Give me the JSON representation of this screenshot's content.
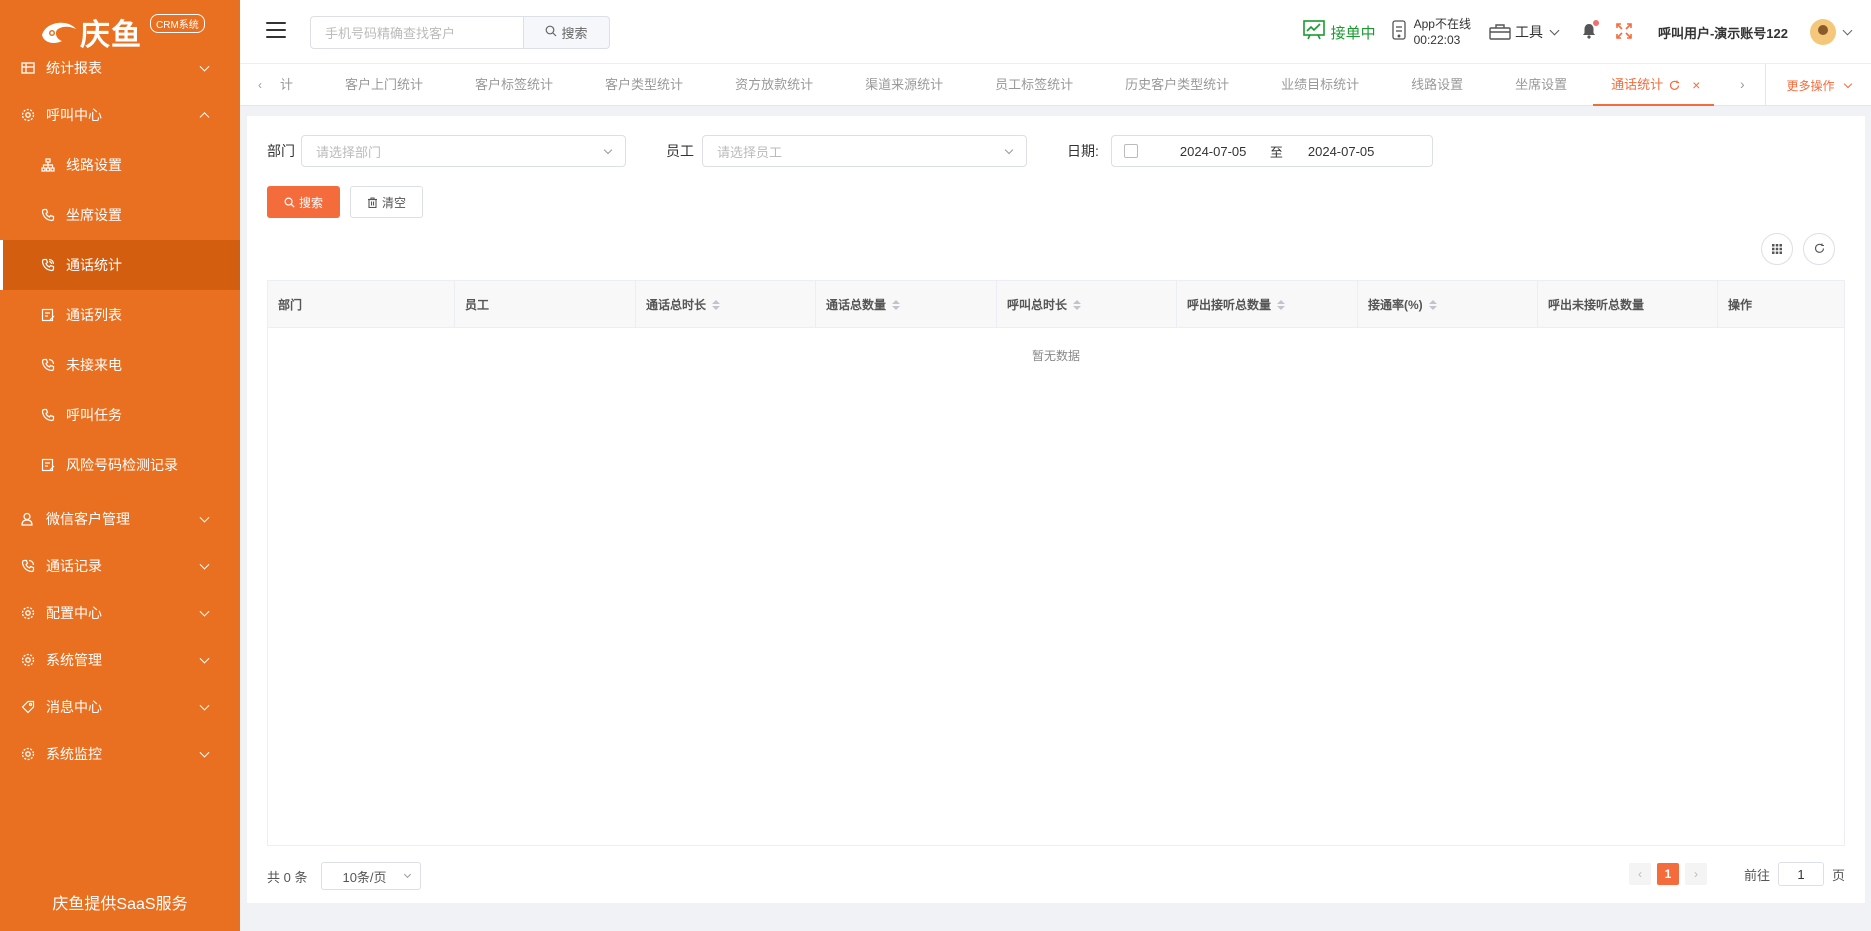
{
  "logo": {
    "text": "庆鱼",
    "badge": "CRM系统"
  },
  "sidebar": {
    "items": [
      {
        "label": "统计报表",
        "icon": "table-icon",
        "expanded": false
      },
      {
        "label": "呼叫中心",
        "icon": "gear-icon",
        "expanded": true,
        "children": [
          {
            "label": "线路设置",
            "icon": "sitemap-icon"
          },
          {
            "label": "坐席设置",
            "icon": "phone-icon"
          },
          {
            "label": "通话统计",
            "icon": "phone-call-icon",
            "active": true
          },
          {
            "label": "通话列表",
            "icon": "edit-list-icon"
          },
          {
            "label": "未接来电",
            "icon": "phone-call-icon"
          },
          {
            "label": "呼叫任务",
            "icon": "phone-icon"
          },
          {
            "label": "风险号码检测记录",
            "icon": "edit-list-icon"
          }
        ]
      },
      {
        "label": "微信客户管理",
        "icon": "user-icon",
        "expanded": false
      },
      {
        "label": "通话记录",
        "icon": "phone-call-icon",
        "expanded": false
      },
      {
        "label": "配置中心",
        "icon": "gear-icon",
        "expanded": false
      },
      {
        "label": "系统管理",
        "icon": "gear-icon",
        "expanded": false
      },
      {
        "label": "消息中心",
        "icon": "tag-icon",
        "expanded": false
      },
      {
        "label": "系统监控",
        "icon": "gear-icon",
        "expanded": false
      }
    ],
    "footer": "庆鱼提供SaaS服务"
  },
  "header": {
    "search_placeholder": "手机号码精确查找客户",
    "search_button": "搜索",
    "status": "接单中",
    "app_status_line1": "App不在线",
    "app_status_line2": "00:22:03",
    "tools": "工具",
    "username": "呼叫用户-演示账号122"
  },
  "tabs": {
    "items": [
      "计",
      "客户上门统计",
      "客户标签统计",
      "客户类型统计",
      "资方放款统计",
      "渠道来源统计",
      "员工标签统计",
      "历史客户类型统计",
      "业绩目标统计",
      "线路设置",
      "坐席设置",
      "通话统计"
    ],
    "more": "更多操作"
  },
  "filters": {
    "dept_label": "部门",
    "dept_placeholder": "请选择部门",
    "staff_label": "员工",
    "staff_placeholder": "请选择员工",
    "date_label": "日期:",
    "date_start": "2024-07-05",
    "date_sep": "至",
    "date_end": "2024-07-05",
    "search_button": "搜索",
    "clear_button": "清空"
  },
  "table": {
    "columns": [
      {
        "label": "部门",
        "sortable": false
      },
      {
        "label": "员工",
        "sortable": false
      },
      {
        "label": "通话总时长",
        "sortable": true
      },
      {
        "label": "通话总数量",
        "sortable": true
      },
      {
        "label": "呼叫总时长",
        "sortable": true
      },
      {
        "label": "呼出接听总数量",
        "sortable": true
      },
      {
        "label": "接通率(%)",
        "sortable": true
      },
      {
        "label": "呼出未接听总数量",
        "sortable": false
      },
      {
        "label": "操作",
        "sortable": false
      }
    ],
    "empty_text": "暂无数据"
  },
  "pagination": {
    "total_text": "共 0 条",
    "page_size": "10条/页",
    "current_page": "1",
    "goto_label": "前往",
    "goto_value": "1",
    "goto_suffix": "页"
  },
  "colors": {
    "sidebar": "#e87020",
    "accent": "#f56c3c",
    "online": "#1a9a30"
  }
}
